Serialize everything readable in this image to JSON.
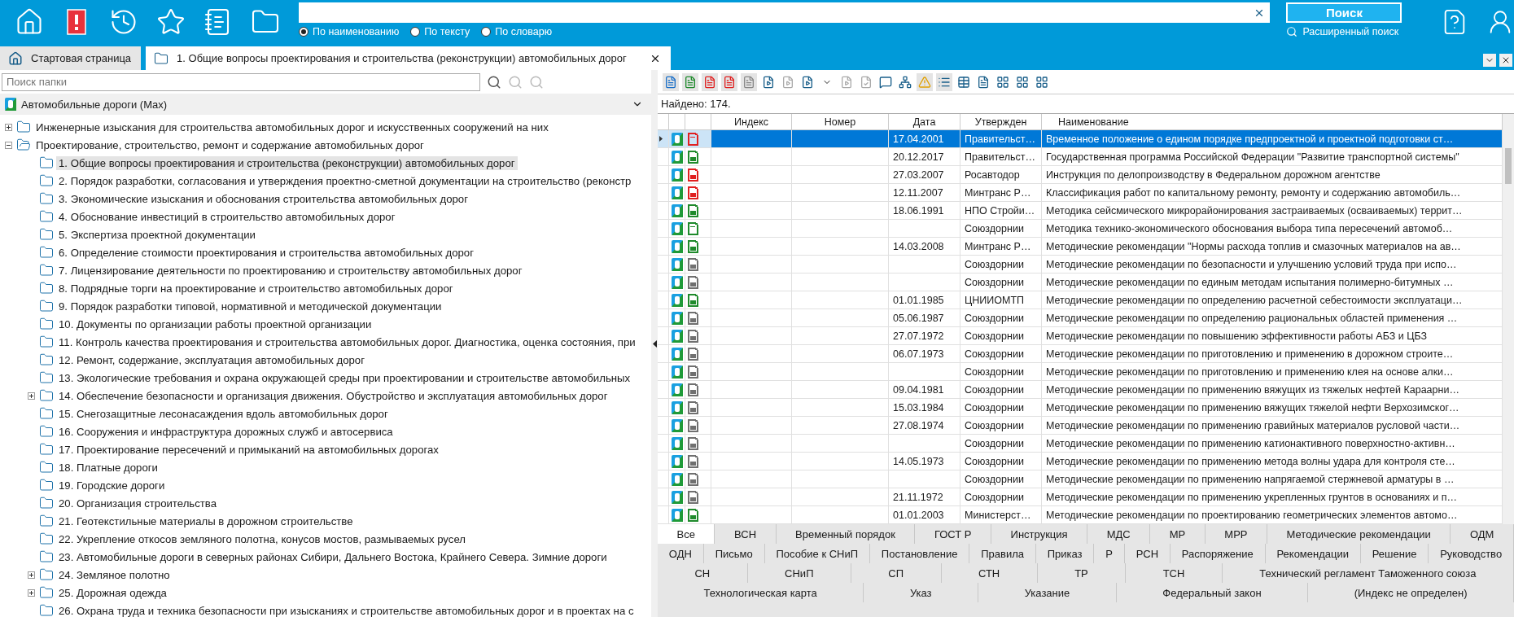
{
  "header": {
    "search_modes": [
      {
        "label": "По наименованию",
        "selected": true
      },
      {
        "label": "По тексту",
        "selected": false
      },
      {
        "label": "По словарю",
        "selected": false
      }
    ],
    "search_button": "Поиск",
    "advanced_search": "Расширенный поиск"
  },
  "tabs": [
    {
      "label": "Стартовая страница",
      "kind": "home",
      "selected": false,
      "closable": false
    },
    {
      "label": "1. Общие вопросы проектирования и строительства (реконструкции) автомобильных дорог",
      "kind": "folder",
      "selected": true,
      "closable": true
    }
  ],
  "folder_search": {
    "placeholder": "Поиск папки"
  },
  "root": "Автомобильные дороги (Max)",
  "tree": [
    {
      "label": "Инженерные изыскания для строительства автомобильных дорог и искусственных сооружений на них",
      "selected": false,
      "expanded": false
    },
    {
      "label": "Проектирование, строительство, ремонт и содержание автомобильных дорог",
      "selected": false,
      "expanded": true,
      "children": [
        {
          "label": "1. Общие вопросы проектирования и строительства (реконструкции) автомобильных дорог",
          "selected": true
        },
        {
          "label": "2. Порядок разработки, согласования и утверждения проектно-сметной документации на строительство (реконстр",
          "selected": false
        },
        {
          "label": "3. Экономические изыскания и обоснования строительства автомобильных дорог",
          "selected": false
        },
        {
          "label": "4. Обоснование инвестиций в строительство автомобильных дорог",
          "selected": false
        },
        {
          "label": "5. Экспертиза проектной документации",
          "selected": false
        },
        {
          "label": "6. Определение стоимости проектирования и строительства автомобильных дорог",
          "selected": false
        },
        {
          "label": "7. Лицензирование деятельности по проектированию и строительству автомобильных дорог",
          "selected": false
        },
        {
          "label": "8. Подрядные торги на проектирование и строительство автомобильных дорог",
          "selected": false
        },
        {
          "label": "9. Порядок разработки типовой, нормативной и методической документации",
          "selected": false
        },
        {
          "label": "10. Документы по организации работы проектной организации",
          "selected": false
        },
        {
          "label": "11. Контроль качества проектирования и строительства автомобильных дорог. Диагностика, оценка состояния, при",
          "selected": false
        },
        {
          "label": "12. Ремонт, содержание, эксплуатация автомобильных дорог",
          "selected": false
        },
        {
          "label": "13. Экологические требования и охрана окружающей среды при проектировании и строительстве автомобильных",
          "selected": false
        },
        {
          "label": "14. Обеспечение безопасности и организация движения. Обустройство и эксплуатация автомобильных дорог",
          "selected": false,
          "expanded": false
        },
        {
          "label": "15. Снегозащитные лесонасаждения вдоль автомобильных дорог",
          "selected": false
        },
        {
          "label": "16. Сооружения и инфраструктура дорожных служб и автосервиса",
          "selected": false
        },
        {
          "label": "17. Проектирование пересечений и примыканий на автомобильных дорогах",
          "selected": false
        },
        {
          "label": "18. Платные дороги",
          "selected": false
        },
        {
          "label": "19. Городские дороги",
          "selected": false
        },
        {
          "label": "20. Организация строительства",
          "selected": false
        },
        {
          "label": "21. Геотекстильные материалы в дорожном строительстве",
          "selected": false
        },
        {
          "label": "22. Укрепление откосов земляного полотна, конусов мостов, размываемых русел",
          "selected": false
        },
        {
          "label": "23. Автомобильные дороги в северных районах Сибири, Дальнего Востока, Крайнего Севера. Зимние дороги",
          "selected": false
        },
        {
          "label": "24. Земляное полотно",
          "selected": false,
          "expanded": false
        },
        {
          "label": "25. Дорожная одежда",
          "selected": false,
          "expanded": false
        },
        {
          "label": "26. Охрана труда и техника безопасности при изысканиях и строительстве автомобильных дорог и в проектах на с",
          "selected": false
        }
      ]
    }
  ],
  "found": "Найдено: 174.",
  "table": {
    "columns": [
      "Индекс",
      "Номер",
      "Дата",
      "Утвержден",
      "Наименование"
    ],
    "rows": [
      {
        "date": "17.04.2001",
        "approved": "Правительст…",
        "name": "Временное положение о едином порядке предпроектной и проектной подготовки ст…",
        "color": "#e02020",
        "kind": "outline",
        "selected": true
      },
      {
        "date": "20.12.2017",
        "approved": "Правительст…",
        "name": "Государственная программа Российской Федерации \"Развитие транспортной системы\"",
        "color": "#1f8a2c",
        "kind": "filled",
        "selected": false
      },
      {
        "date": "27.03.2007",
        "approved": "Росавтодор",
        "name": "Инструкция по делопроизводству в Федеральном дорожном агентстве",
        "color": "#e02020",
        "kind": "filled",
        "selected": false
      },
      {
        "date": "12.11.2007",
        "approved": "Минтранс Р…",
        "name": "Классификация работ по капитальному ремонту, ремонту и содержанию автомобиль…",
        "color": "#e02020",
        "kind": "filled",
        "selected": false
      },
      {
        "date": "18.06.1991",
        "approved": "НПО Стройи…",
        "name": "Методика сейсмического микрорайонирования застраиваемых (осваиваемых) террит…",
        "color": "#1f8a2c",
        "kind": "filled",
        "selected": false
      },
      {
        "date": "",
        "approved": "Союздорнии",
        "name": "Методика технико-экономического обоснования выбора типа пересечений автомоб…",
        "color": "#1f8a2c",
        "kind": "outline",
        "selected": false
      },
      {
        "date": "14.03.2008",
        "approved": "Минтранс Р…",
        "name": "Методические рекомендации \"Нормы расхода топлив и смазочных материалов на ав…",
        "color": "#1f8a2c",
        "kind": "filled",
        "selected": false
      },
      {
        "date": "",
        "approved": "Союздорнии",
        "name": "Методические рекомендации по безопасности и улучшению условий труда при испо…",
        "color": "#707070",
        "kind": "filled",
        "selected": false
      },
      {
        "date": "",
        "approved": "Союздорнии",
        "name": "Методические рекомендации по единым методам испытания полимерно-битумных …",
        "color": "#707070",
        "kind": "filled",
        "selected": false
      },
      {
        "date": "01.01.1985",
        "approved": "ЦНИИОМТП",
        "name": "Методические рекомендации по определению расчетной себестоимости эксплуатаци…",
        "color": "#1f8a2c",
        "kind": "filled",
        "selected": false
      },
      {
        "date": "05.06.1987",
        "approved": "Союздорнии",
        "name": "Методические рекомендации по определению рациональных областей применения …",
        "color": "#707070",
        "kind": "filled",
        "selected": false
      },
      {
        "date": "27.07.1972",
        "approved": "Союздорнии",
        "name": "Методические рекомендации по повышению эффективности работы АБЗ и ЦБЗ",
        "color": "#707070",
        "kind": "filled",
        "selected": false
      },
      {
        "date": "06.07.1973",
        "approved": "Союздорнии",
        "name": "Методические рекомендации по приготовлению и применению в дорожном строите…",
        "color": "#707070",
        "kind": "filled",
        "selected": false
      },
      {
        "date": "",
        "approved": "Союздорнии",
        "name": "Методические рекомендации по приготовлению и применению клея на основе алки…",
        "color": "#707070",
        "kind": "filled",
        "selected": false
      },
      {
        "date": "09.04.1981",
        "approved": "Союздорнии",
        "name": "Методические рекомендации по применению вяжущих из тяжелых нефтей Караарни…",
        "color": "#707070",
        "kind": "filled",
        "selected": false
      },
      {
        "date": "15.03.1984",
        "approved": "Союздорнии",
        "name": "Методические рекомендации по применению вяжущих тяжелой нефти Верхозимског…",
        "color": "#707070",
        "kind": "filled",
        "selected": false
      },
      {
        "date": "27.08.1974",
        "approved": "Союздорнии",
        "name": "Методические рекомендации по применению гравийных материалов русловой части…",
        "color": "#707070",
        "kind": "filled",
        "selected": false
      },
      {
        "date": "",
        "approved": "Союздорнии",
        "name": "Методические рекомендации по применению катионактивного поверхностно-активн…",
        "color": "#707070",
        "kind": "filled",
        "selected": false
      },
      {
        "date": "14.05.1973",
        "approved": "Союздорнии",
        "name": "Методические рекомендации по применению метода волны удара для контроля сте…",
        "color": "#707070",
        "kind": "filled",
        "selected": false
      },
      {
        "date": "",
        "approved": "Союздорнии",
        "name": "Методические рекомендации по применению напрягаемой стержневой арматуры в …",
        "color": "#707070",
        "kind": "filled",
        "selected": false
      },
      {
        "date": "21.11.1972",
        "approved": "Союздорнии",
        "name": "Методические рекомендации по применению укрепленных грунтов в основаниях и п…",
        "color": "#707070",
        "kind": "filled",
        "selected": false
      },
      {
        "date": "01.01.2003",
        "approved": "Министерст…",
        "name": "Методические рекомендации по проектированию геометрических элементов автомо…",
        "color": "#1f8a2c",
        "kind": "filled",
        "selected": false
      }
    ]
  },
  "filter_tabs": [
    [
      {
        "label": "Все",
        "selected": true
      },
      {
        "label": "ВСН",
        "selected": false
      },
      {
        "label": "Временный порядок",
        "selected": false
      },
      {
        "label": "ГОСТ Р",
        "selected": false
      },
      {
        "label": "Инструкция",
        "selected": false
      },
      {
        "label": "МДС",
        "selected": false
      },
      {
        "label": "МР",
        "selected": false
      },
      {
        "label": "МРР",
        "selected": false
      },
      {
        "label": "Методические рекомендации",
        "selected": false
      },
      {
        "label": "ОДМ",
        "selected": false
      }
    ],
    [
      {
        "label": "ОДН",
        "selected": false
      },
      {
        "label": "Письмо",
        "selected": false
      },
      {
        "label": "Пособие к СНиП",
        "selected": false
      },
      {
        "label": "Постановление",
        "selected": false
      },
      {
        "label": "Правила",
        "selected": false
      },
      {
        "label": "Приказ",
        "selected": false
      },
      {
        "label": "Р",
        "selected": false
      },
      {
        "label": "РСН",
        "selected": false
      },
      {
        "label": "Распоряжение",
        "selected": false
      },
      {
        "label": "Рекомендации",
        "selected": false
      },
      {
        "label": "Решение",
        "selected": false
      },
      {
        "label": "Руководство",
        "selected": false
      }
    ],
    [
      {
        "label": "СН",
        "selected": false
      },
      {
        "label": "СНиП",
        "selected": false
      },
      {
        "label": "СП",
        "selected": false
      },
      {
        "label": "СТН",
        "selected": false
      },
      {
        "label": "ТР",
        "selected": false
      },
      {
        "label": "ТСН",
        "selected": false
      },
      {
        "label": "Технический регламент Таможенного союза",
        "selected": false
      }
    ],
    [
      {
        "label": "Технологическая карта",
        "selected": false
      },
      {
        "label": "Указ",
        "selected": false
      },
      {
        "label": "Указание",
        "selected": false
      },
      {
        "label": "Федеральный закон",
        "selected": false
      },
      {
        "label": "(Индекс не определен)",
        "selected": false
      }
    ]
  ]
}
